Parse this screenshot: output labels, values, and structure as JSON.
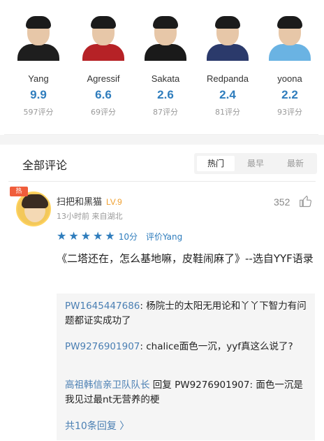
{
  "players": [
    {
      "name": "Yang",
      "score": "9.9",
      "count": "597评分",
      "jersey": "#1e1e1e"
    },
    {
      "name": "Agressif",
      "score": "6.6",
      "count": "69评分",
      "jersey": "#b62226"
    },
    {
      "name": "Sakata",
      "score": "2.6",
      "count": "87评分",
      "jersey": "#1a1a1a"
    },
    {
      "name": "Redpanda",
      "score": "2.4",
      "count": "81评分",
      "jersey": "#2b3a6b"
    },
    {
      "name": "yoona",
      "score": "2.2",
      "count": "93评分",
      "jersey": "#6ab3e3"
    }
  ],
  "comments_header": {
    "title": "全部评论",
    "tabs": [
      "热门",
      "最早",
      "最新"
    ],
    "active_tab": "热门"
  },
  "comment": {
    "hot_badge": "热",
    "username": "扫把和黑猫",
    "level": "LV.9",
    "meta": "13小时前 来自湖北",
    "likes": "352",
    "stars": 5,
    "rating_score": "10分",
    "rating_target": "评价Yang",
    "text": "《二塔还在，怎么基地嘛，皮鞋闹麻了》--选自YYF语录",
    "replies": [
      {
        "user": "PW1645447686",
        "sep": ": ",
        "text": "杨院士的太阳无用论和丫丫下智力有问题都证实成功了"
      },
      {
        "user": "PW9276901907",
        "sep": ": ",
        "text": "chalice面色一沉，yyf真这么说了?"
      },
      {
        "user": "高祖韩信亲卫队队长",
        "reply_word": " 回复 ",
        "target": "PW9276901907",
        "sep": ": ",
        "text": "面色一沉是我见过最nt无营养的梗"
      }
    ],
    "more_replies": "共10条回复 〉"
  },
  "colors": {
    "accent": "#2f7dbd",
    "reply_user": "#4a7fb3",
    "hot": "#f05d3b",
    "level": "#f0a030"
  }
}
